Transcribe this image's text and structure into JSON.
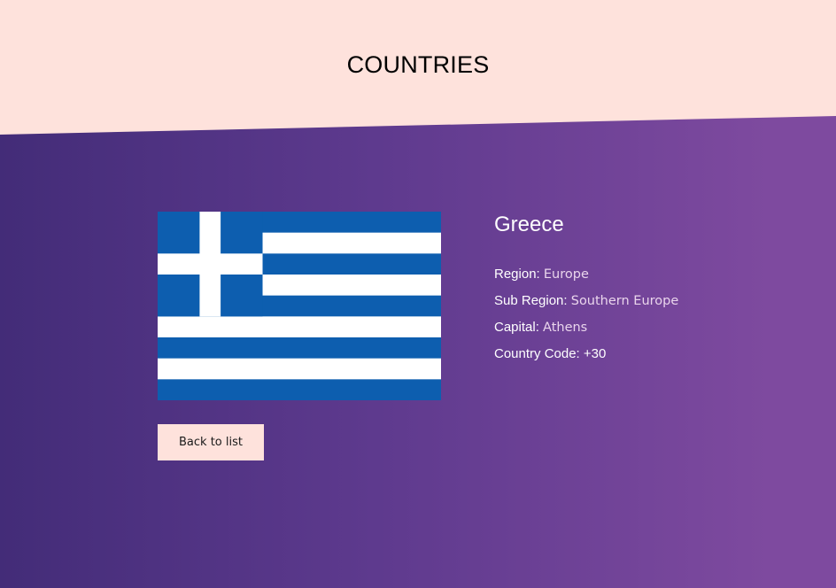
{
  "header": {
    "title": "COUNTRIES"
  },
  "country": {
    "name": "Greece",
    "flag_icon": "greece-flag",
    "details": [
      {
        "label": "Region:",
        "value": "Europe"
      },
      {
        "label": "Sub Region:",
        "value": "Southern Europe"
      },
      {
        "label": "Capital:",
        "value": "Athens"
      },
      {
        "label": "Country Code:",
        "value": "+30"
      }
    ]
  },
  "actions": {
    "back_label": "Back to list"
  },
  "colors": {
    "header_bg": "#fee2dc",
    "gradient_start": "#432c78",
    "gradient_end": "#7e4a9f",
    "flag_blue": "#0d5eaf",
    "flag_white": "#ffffff",
    "value_text": "#ead5ec"
  }
}
